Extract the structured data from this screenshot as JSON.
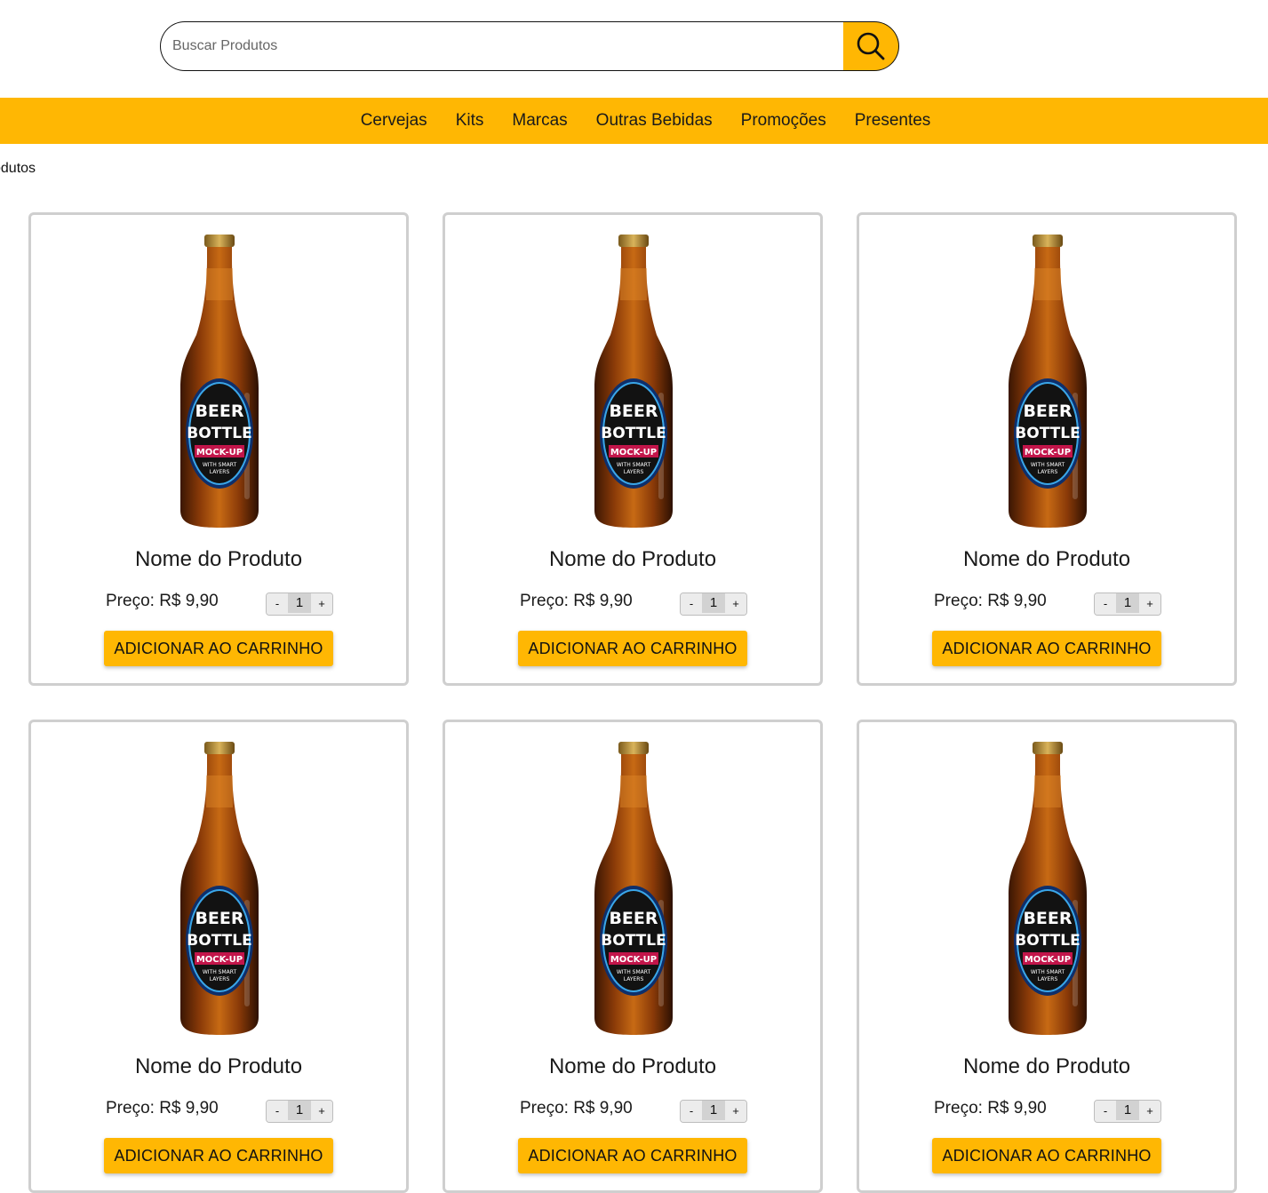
{
  "search": {
    "placeholder": "Buscar Produtos"
  },
  "nav": {
    "items": [
      "Cervejas",
      "Kits",
      "Marcas",
      "Outras Bebidas",
      "Promoções",
      "Presentes"
    ]
  },
  "breadcrumb": "Produtos",
  "colors": {
    "accent": "#FFB703",
    "card_border": "#cfcfcf"
  },
  "bottle_label": {
    "line1": "BEER",
    "line2": "BOTTLE",
    "line3": "MOCK-UP",
    "line4": "WITH SMART",
    "line5": "LAYERS"
  },
  "products": [
    {
      "name": "Nome do Produto",
      "price": "Preço: R$ 9,90",
      "qty": "1",
      "minus": "-",
      "plus": "+",
      "add_label": "ADICIONAR AO CARRINHO"
    },
    {
      "name": "Nome do Produto",
      "price": "Preço: R$ 9,90",
      "qty": "1",
      "minus": "-",
      "plus": "+",
      "add_label": "ADICIONAR AO CARRINHO"
    },
    {
      "name": "Nome do Produto",
      "price": "Preço: R$ 9,90",
      "qty": "1",
      "minus": "-",
      "plus": "+",
      "add_label": "ADICIONAR AO CARRINHO"
    },
    {
      "name": "Nome do Produto",
      "price": "Preço: R$ 9,90",
      "qty": "1",
      "minus": "-",
      "plus": "+",
      "add_label": "ADICIONAR AO CARRINHO"
    },
    {
      "name": "Nome do Produto",
      "price": "Preço: R$ 9,90",
      "qty": "1",
      "minus": "-",
      "plus": "+",
      "add_label": "ADICIONAR AO CARRINHO"
    },
    {
      "name": "Nome do Produto",
      "price": "Preço: R$ 9,90",
      "qty": "1",
      "minus": "-",
      "plus": "+",
      "add_label": "ADICIONAR AO CARRINHO"
    }
  ]
}
